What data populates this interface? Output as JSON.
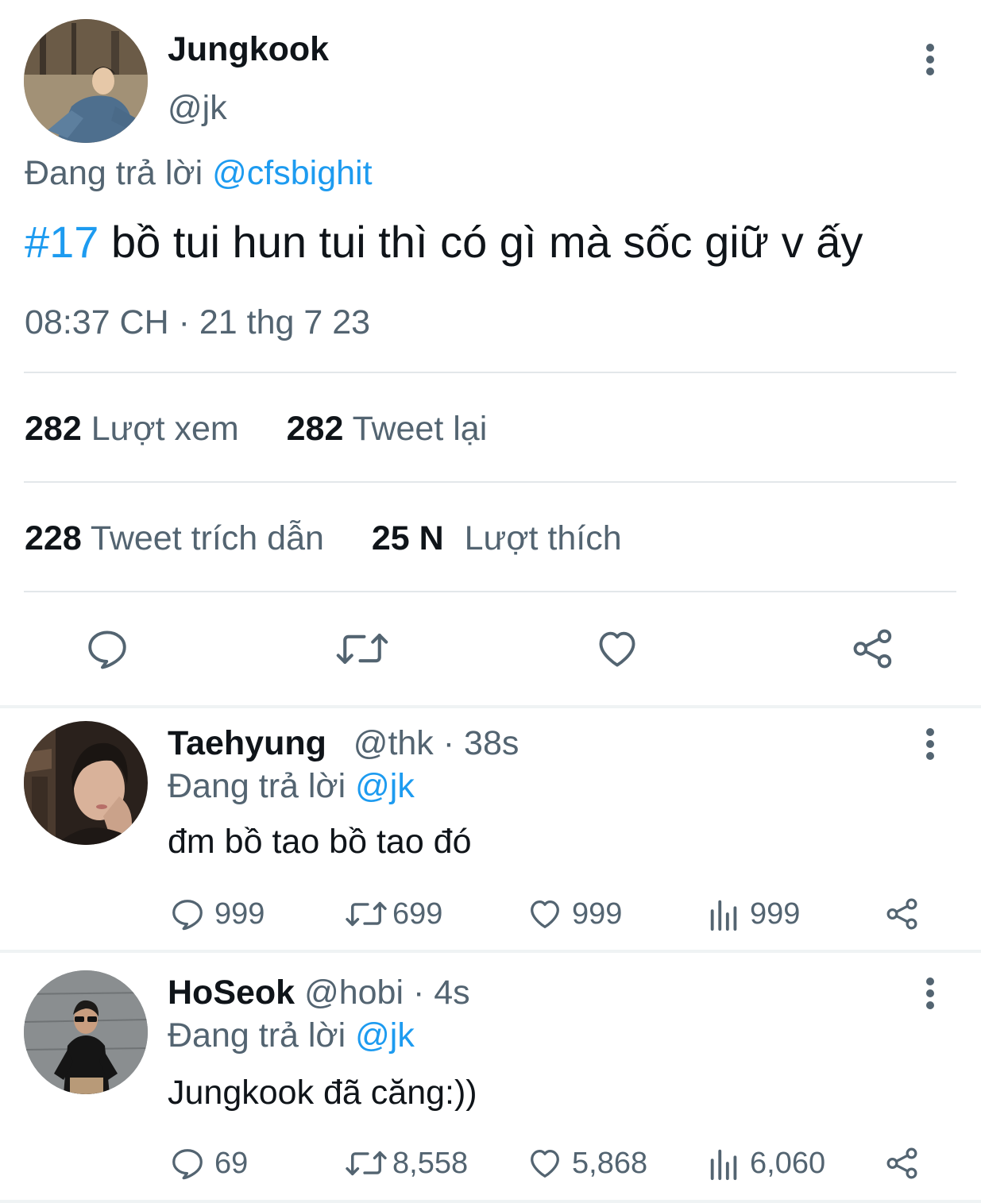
{
  "main_tweet": {
    "author_name": "Jungkook",
    "author_handle": "@jk",
    "reply_prefix": "Đang trả lời",
    "reply_to": "@cfsbighit",
    "hashtag": "#17",
    "text": " bồ tui hun tui thì có gì mà sốc giữ v ấy",
    "timestamp": "08:37 CH · 21 thg 7 23",
    "stats": {
      "views_count": "282",
      "views_label": "Lượt xem",
      "retweets_count": "282",
      "retweets_label": "Tweet lại",
      "quotes_count": "228",
      "quotes_label": "Tweet trích dẫn",
      "likes_count": "25 N",
      "likes_label": "Lượt thích"
    },
    "actions": [
      "reply-icon",
      "retweet-icon",
      "like-icon",
      "share-icon"
    ]
  },
  "replies": [
    {
      "name": "Taehyung",
      "handle": "@thk",
      "time": "38s",
      "reply_prefix": "Đang trả lời",
      "reply_to": "@jk",
      "text": "đm bồ tao bồ tao đó",
      "replies": "999",
      "retweets": "699",
      "likes": "999",
      "views": "999"
    },
    {
      "name": "HoSeok",
      "handle": "@hobi",
      "time": "4s",
      "reply_prefix": "Đang trả lời",
      "reply_to": "@jk",
      "text": "Jungkook đã căng:))",
      "replies": "69",
      "retweets": "8,558",
      "likes": "5,868",
      "views": "6,060"
    }
  ],
  "colors": {
    "accent": "#1d9bf0",
    "secondary_text": "#536471",
    "primary_text": "#0f1419",
    "divider": "#e3e7ea"
  }
}
